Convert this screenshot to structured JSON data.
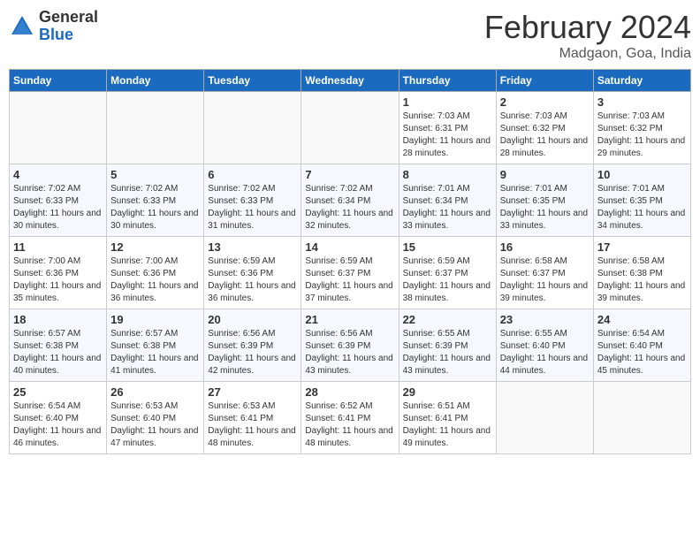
{
  "header": {
    "logo_general": "General",
    "logo_blue": "Blue",
    "title": "February 2024",
    "subtitle": "Madgaon, Goa, India"
  },
  "weekdays": [
    "Sunday",
    "Monday",
    "Tuesday",
    "Wednesday",
    "Thursday",
    "Friday",
    "Saturday"
  ],
  "weeks": [
    [
      {
        "day": "",
        "info": ""
      },
      {
        "day": "",
        "info": ""
      },
      {
        "day": "",
        "info": ""
      },
      {
        "day": "",
        "info": ""
      },
      {
        "day": "1",
        "info": "Sunrise: 7:03 AM\nSunset: 6:31 PM\nDaylight: 11 hours and 28 minutes."
      },
      {
        "day": "2",
        "info": "Sunrise: 7:03 AM\nSunset: 6:32 PM\nDaylight: 11 hours and 28 minutes."
      },
      {
        "day": "3",
        "info": "Sunrise: 7:03 AM\nSunset: 6:32 PM\nDaylight: 11 hours and 29 minutes."
      }
    ],
    [
      {
        "day": "4",
        "info": "Sunrise: 7:02 AM\nSunset: 6:33 PM\nDaylight: 11 hours and 30 minutes."
      },
      {
        "day": "5",
        "info": "Sunrise: 7:02 AM\nSunset: 6:33 PM\nDaylight: 11 hours and 30 minutes."
      },
      {
        "day": "6",
        "info": "Sunrise: 7:02 AM\nSunset: 6:33 PM\nDaylight: 11 hours and 31 minutes."
      },
      {
        "day": "7",
        "info": "Sunrise: 7:02 AM\nSunset: 6:34 PM\nDaylight: 11 hours and 32 minutes."
      },
      {
        "day": "8",
        "info": "Sunrise: 7:01 AM\nSunset: 6:34 PM\nDaylight: 11 hours and 33 minutes."
      },
      {
        "day": "9",
        "info": "Sunrise: 7:01 AM\nSunset: 6:35 PM\nDaylight: 11 hours and 33 minutes."
      },
      {
        "day": "10",
        "info": "Sunrise: 7:01 AM\nSunset: 6:35 PM\nDaylight: 11 hours and 34 minutes."
      }
    ],
    [
      {
        "day": "11",
        "info": "Sunrise: 7:00 AM\nSunset: 6:36 PM\nDaylight: 11 hours and 35 minutes."
      },
      {
        "day": "12",
        "info": "Sunrise: 7:00 AM\nSunset: 6:36 PM\nDaylight: 11 hours and 36 minutes."
      },
      {
        "day": "13",
        "info": "Sunrise: 6:59 AM\nSunset: 6:36 PM\nDaylight: 11 hours and 36 minutes."
      },
      {
        "day": "14",
        "info": "Sunrise: 6:59 AM\nSunset: 6:37 PM\nDaylight: 11 hours and 37 minutes."
      },
      {
        "day": "15",
        "info": "Sunrise: 6:59 AM\nSunset: 6:37 PM\nDaylight: 11 hours and 38 minutes."
      },
      {
        "day": "16",
        "info": "Sunrise: 6:58 AM\nSunset: 6:37 PM\nDaylight: 11 hours and 39 minutes."
      },
      {
        "day": "17",
        "info": "Sunrise: 6:58 AM\nSunset: 6:38 PM\nDaylight: 11 hours and 39 minutes."
      }
    ],
    [
      {
        "day": "18",
        "info": "Sunrise: 6:57 AM\nSunset: 6:38 PM\nDaylight: 11 hours and 40 minutes."
      },
      {
        "day": "19",
        "info": "Sunrise: 6:57 AM\nSunset: 6:38 PM\nDaylight: 11 hours and 41 minutes."
      },
      {
        "day": "20",
        "info": "Sunrise: 6:56 AM\nSunset: 6:39 PM\nDaylight: 11 hours and 42 minutes."
      },
      {
        "day": "21",
        "info": "Sunrise: 6:56 AM\nSunset: 6:39 PM\nDaylight: 11 hours and 43 minutes."
      },
      {
        "day": "22",
        "info": "Sunrise: 6:55 AM\nSunset: 6:39 PM\nDaylight: 11 hours and 43 minutes."
      },
      {
        "day": "23",
        "info": "Sunrise: 6:55 AM\nSunset: 6:40 PM\nDaylight: 11 hours and 44 minutes."
      },
      {
        "day": "24",
        "info": "Sunrise: 6:54 AM\nSunset: 6:40 PM\nDaylight: 11 hours and 45 minutes."
      }
    ],
    [
      {
        "day": "25",
        "info": "Sunrise: 6:54 AM\nSunset: 6:40 PM\nDaylight: 11 hours and 46 minutes."
      },
      {
        "day": "26",
        "info": "Sunrise: 6:53 AM\nSunset: 6:40 PM\nDaylight: 11 hours and 47 minutes."
      },
      {
        "day": "27",
        "info": "Sunrise: 6:53 AM\nSunset: 6:41 PM\nDaylight: 11 hours and 48 minutes."
      },
      {
        "day": "28",
        "info": "Sunrise: 6:52 AM\nSunset: 6:41 PM\nDaylight: 11 hours and 48 minutes."
      },
      {
        "day": "29",
        "info": "Sunrise: 6:51 AM\nSunset: 6:41 PM\nDaylight: 11 hours and 49 minutes."
      },
      {
        "day": "",
        "info": ""
      },
      {
        "day": "",
        "info": ""
      }
    ]
  ]
}
